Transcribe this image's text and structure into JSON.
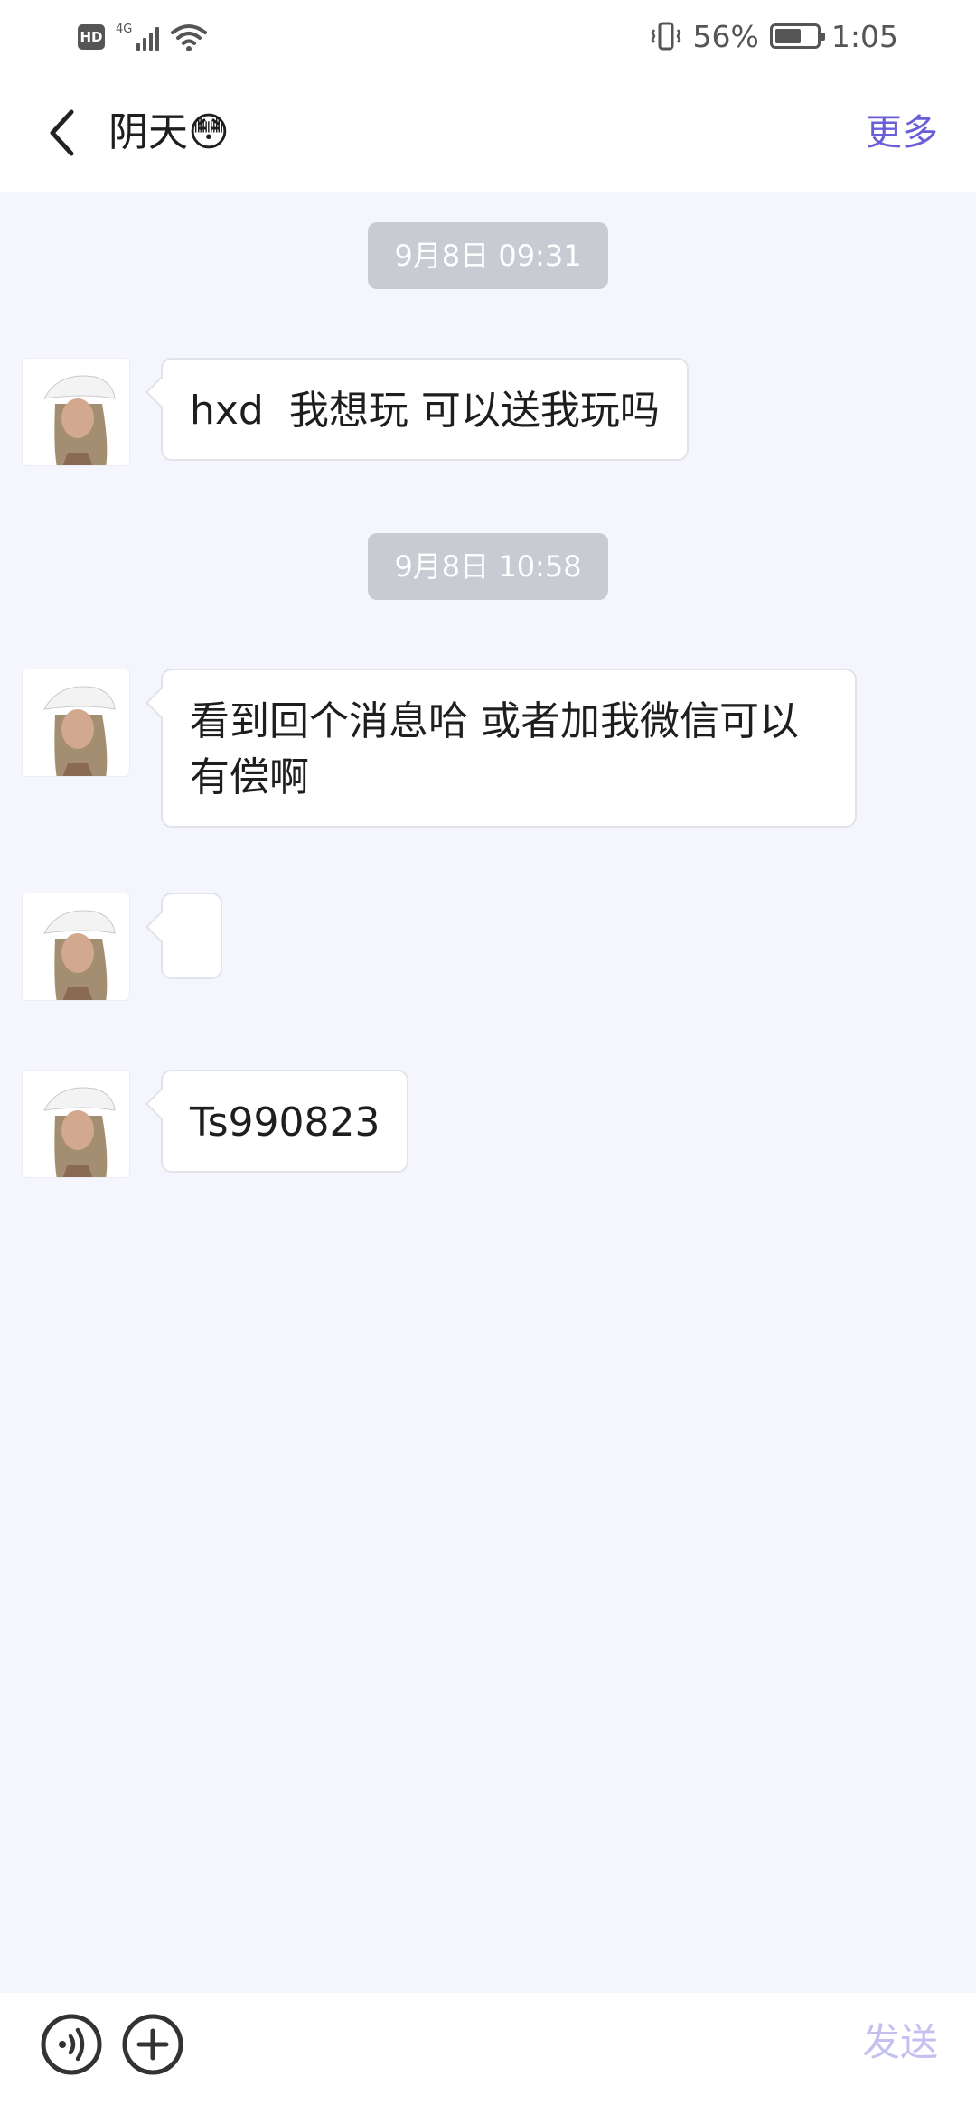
{
  "status_bar": {
    "network": "4G",
    "hd": "HD",
    "battery_percent": "56%",
    "time": "1:05"
  },
  "header": {
    "title": "阴天😳",
    "more_label": "更多"
  },
  "messages": [
    {
      "type": "timestamp",
      "text": "9月8日 09:31"
    },
    {
      "type": "incoming",
      "text": "hxd  我想玩 可以送我玩吗"
    },
    {
      "type": "timestamp",
      "text": "9月8日 10:58"
    },
    {
      "type": "incoming",
      "text": "看到回个消息哈 或者加我微信可以有偿啊"
    },
    {
      "type": "incoming",
      "text": ""
    },
    {
      "type": "incoming",
      "text": "Ts990823"
    }
  ],
  "input_bar": {
    "send_label": "发送"
  },
  "colors": {
    "accent": "#6a5ed8",
    "send_disabled": "#c4c0ef",
    "chat_bg": "#f5f6fd",
    "timestamp_bg": "#c9cbd3"
  }
}
